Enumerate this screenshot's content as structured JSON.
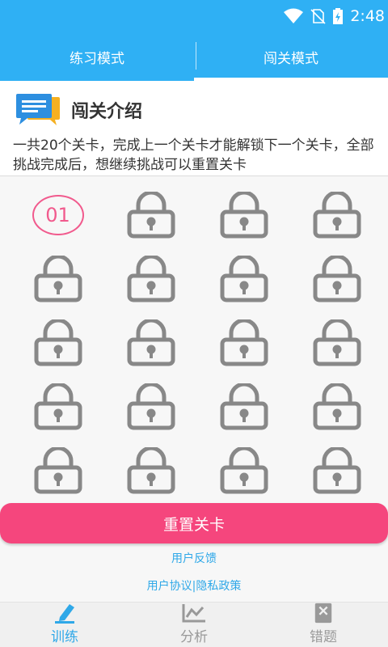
{
  "status_bar": {
    "time": "2:48"
  },
  "tabs": [
    {
      "label": "练习模式",
      "active": false
    },
    {
      "label": "闯关模式",
      "active": true
    }
  ],
  "intro": {
    "icon": "chat-bubble-icon",
    "title": "闯关介绍",
    "description": "一共20个关卡，完成上一个关卡才能解锁下一个关卡，全部挑战完成后，想继续挑战可以重置关卡"
  },
  "levels": {
    "current_label": "01",
    "total": 20,
    "locked_icon": "lock-icon"
  },
  "reset_button": "重置关卡",
  "links": {
    "feedback": "用户反馈",
    "agreement": "用户协议|隐私政策"
  },
  "bottom_nav": [
    {
      "label": "训练",
      "icon": "pencil-icon",
      "active": true
    },
    {
      "label": "分析",
      "icon": "chart-icon",
      "active": false
    },
    {
      "label": "错题",
      "icon": "error-book-icon",
      "active": false
    }
  ],
  "colors": {
    "primary": "#2fb0f4",
    "accent": "#f5467d",
    "lock": "#888888"
  }
}
